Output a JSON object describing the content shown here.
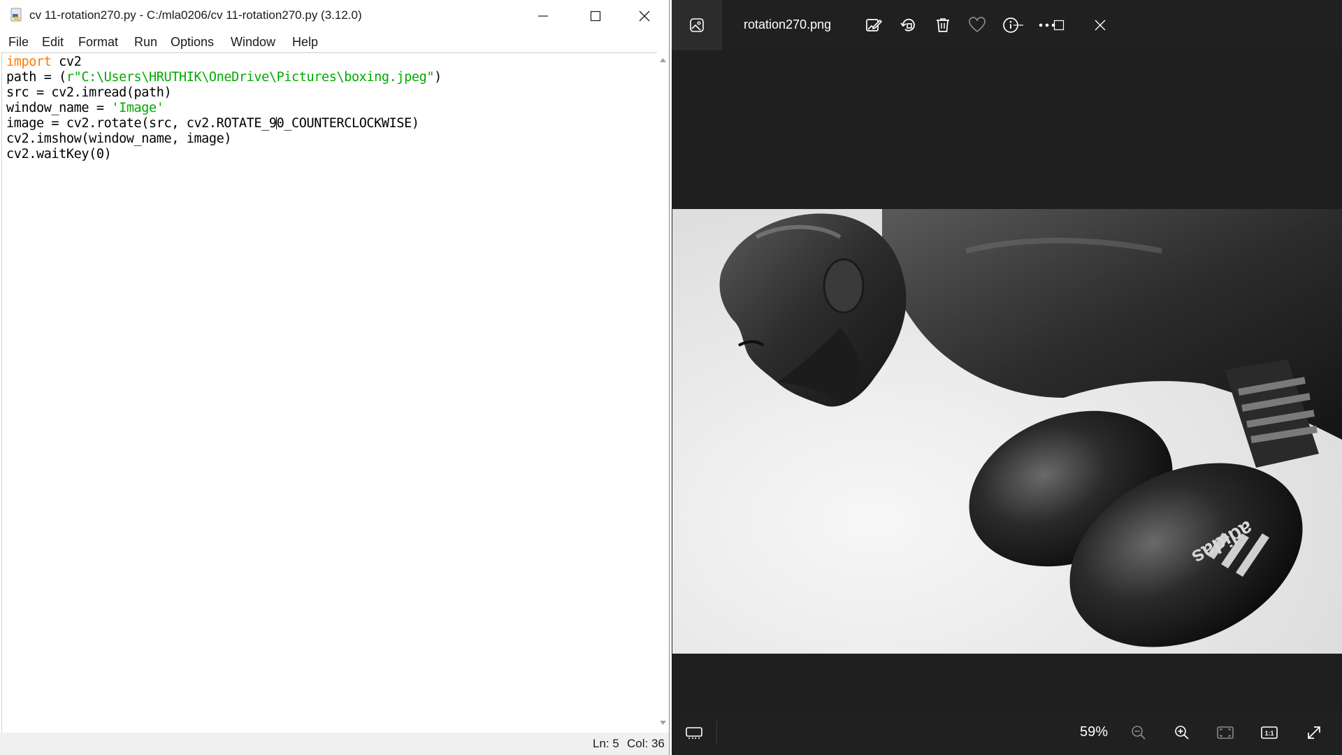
{
  "idle": {
    "title": "cv 11-rotation270.py - C:/mla0206/cv 11-rotation270.py (3.12.0)",
    "menu": [
      "File",
      "Edit",
      "Format",
      "Run",
      "Options",
      "Window",
      "Help"
    ],
    "code": {
      "line1_kw": "import",
      "line1_rest": " cv2",
      "line2_a": "path = (",
      "line2_str": "r\"C:\\Users\\HRUTHIK\\OneDrive\\Pictures\\boxing.jpeg\"",
      "line2_b": ")",
      "line3": "src = cv2.imread(path)",
      "line4_a": "window_name = ",
      "line4_str": "'Image'",
      "line5_a": "image = cv2.rotate(src, cv2.ROTATE_9",
      "line5_b": "0_COUNTERCLOCKWISE)",
      "line6": "cv2.imshow(window_name, image)",
      "line7": "cv2.waitKey(0)"
    },
    "status": {
      "ln": "Ln: 5",
      "col": "Col: 36"
    },
    "colors": {
      "keyword": "#ff7700",
      "string": "#00aa00"
    }
  },
  "photos": {
    "file_name": "rotation270.png",
    "toolbar_icons": [
      "photos-app-icon",
      "edit-image-icon",
      "rotate-icon",
      "delete-icon",
      "favorite-heart-icon",
      "info-icon",
      "more-icon"
    ],
    "zoom": "59%",
    "bottom_icons": [
      "filmstrip-icon",
      "zoom-out-icon",
      "zoom-in-icon",
      "fit-to-window-icon",
      "actual-size-icon",
      "fullscreen-icon"
    ],
    "actual_size_label": "1:1",
    "image_subject": "black-and-white photo of a boxer wearing boxing gloves, rotated"
  }
}
